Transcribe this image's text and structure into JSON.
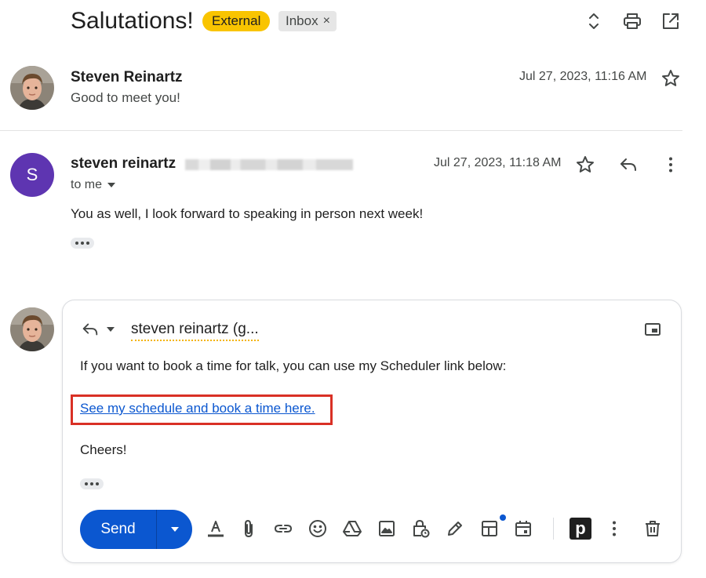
{
  "header": {
    "subject": "Salutations!",
    "labels": {
      "external": "External",
      "inbox": "Inbox"
    },
    "label_remove_glyph": "×"
  },
  "messages": [
    {
      "sender": "Steven Reinartz",
      "snippet": "Good to meet you!",
      "date": "Jul 27, 2023, 11:16 AM",
      "avatar": "photo"
    },
    {
      "sender": "steven reinartz",
      "avatar_letter": "S",
      "recipient_line": "to me",
      "date": "Jul 27, 2023, 11:18 AM",
      "body": "You as well, I look forward to speaking in person next week!"
    }
  ],
  "compose": {
    "recipient": "steven reinartz (g...",
    "line1": "If you want to book a time for talk, you can use my Scheduler link below:",
    "link_text": "See my schedule and book a time here.",
    "signoff": "Cheers!",
    "send_label": "Send",
    "extension_letter": "p"
  },
  "colors": {
    "external_badge": "#f9c400",
    "inbox_badge": "#e6e6e6",
    "avatar_purple": "#5e35b1",
    "send_button": "#0b57d0",
    "link": "#0b57d0",
    "highlight": "#d93025"
  },
  "icons": [
    "expand-collapse-icon",
    "print-icon",
    "open-in-new-window-icon",
    "star-icon",
    "reply-icon",
    "more-vert-icon",
    "chevron-down-icon",
    "pop-out-icon",
    "text-format-icon",
    "attach-icon",
    "link-icon",
    "emoji-icon",
    "drive-icon",
    "photo-icon",
    "confidential-icon",
    "signature-icon",
    "layout-icon",
    "calendar-icon",
    "trash-icon"
  ]
}
